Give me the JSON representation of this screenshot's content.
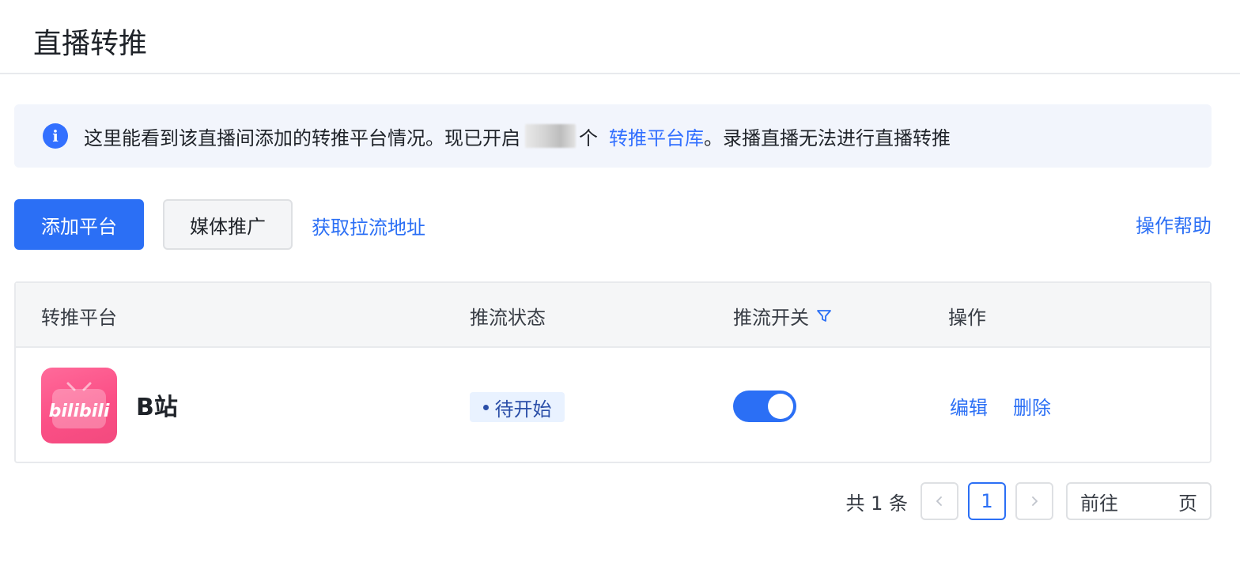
{
  "page": {
    "title": "直播转推"
  },
  "notice": {
    "text_before": "这里能看到该直播间添加的转推平台情况。现已开启",
    "count_suffix": "个",
    "link_text": "转推平台库",
    "text_after": "。录播直播无法进行直播转推",
    "icon": "info-icon"
  },
  "toolbar": {
    "add_platform_label": "添加平台",
    "media_promo_label": "媒体推广",
    "get_pull_url_label": "获取拉流地址",
    "help_label": "操作帮助"
  },
  "table": {
    "columns": {
      "platform": "转推平台",
      "status": "推流状态",
      "switch": "推流开关",
      "actions": "操作"
    },
    "rows": [
      {
        "platform_name": "B站",
        "logo_text": "bilibili",
        "status": "待开始",
        "switch_on": true,
        "edit_label": "编辑",
        "delete_label": "删除"
      }
    ]
  },
  "pagination": {
    "total_text": "共 1 条",
    "current_page": "1",
    "goto_prefix": "前往",
    "goto_suffix": "页",
    "goto_value": ""
  },
  "colors": {
    "primary": "#2b6ff5",
    "notice_bg": "#f2f5fc",
    "logo_pink": "#fb4f86",
    "status_bg": "#e9f2ff"
  }
}
